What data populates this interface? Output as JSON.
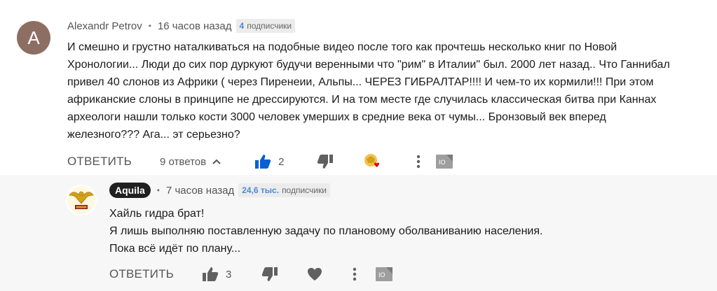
{
  "comment": {
    "avatar_letter": "A",
    "author": "Alexandr Petrov",
    "time": "16 часов назад",
    "subscribers_count": "4",
    "subscribers_label": "подписчики",
    "lines": [
      "И смешно и грустно  наталкиваться на подобные видео после того как прочтешь несколько книг по Новой",
      "Хронологии...  Люди до сих пор дуркуют будучи веренными что \"рим\" в Италии\" был. 2000 лет назад..  Что Ганнибал",
      "привел 40 слонов из Африки ( через Пиренеии, Альпы... ЧЕРЕЗ ГИБРАЛТАР!!!! И чем-то их кормили!!! При этом",
      "африканские слоны в принципе не дрессируются.   И на том месте где случилась классическая битва при Каннах",
      "археологи нашли только кости 3000 человек умерших в средние века от чумы...  Бронзовый век вперед",
      "железного??? Ага... эт серьезно?"
    ],
    "reply_label": "ОТВЕТИТЬ",
    "replies_label": "9 ответов",
    "likes": "2",
    "icons": [
      "thumb-up-icon",
      "thumb-down-icon",
      "creator-heart-icon",
      "more-vert-icon",
      "translate-icon"
    ]
  },
  "reply": {
    "author": "Aquila",
    "time": "7 часов назад",
    "subscribers_count": "24,6 тыс.",
    "subscribers_label": "подписчики",
    "lines": [
      "Хайль гидра брат!",
      "Я лишь выполняю поставленную задачу по плановому оболваниванию населения.",
      "Пока всё идёт по плану..."
    ],
    "reply_label": "ОТВЕТИТЬ",
    "likes": "3",
    "icons": [
      "thumb-up-icon",
      "thumb-down-icon",
      "heart-icon",
      "more-vert-icon",
      "translate-icon"
    ]
  },
  "colors": {
    "accent_blue": "#065fd4",
    "badge_blue": "#4a8ad6",
    "heart_red": "#e00000",
    "icon_grey": "#606060",
    "gold": "#d4a017"
  }
}
